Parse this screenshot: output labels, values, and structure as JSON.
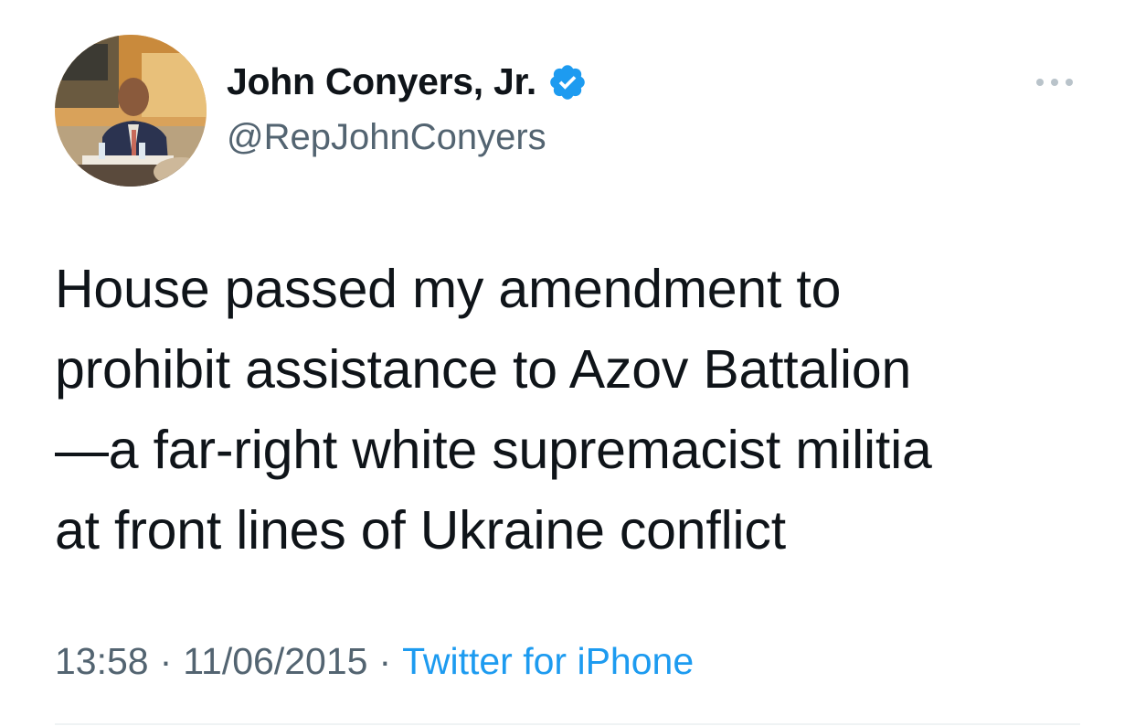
{
  "tweet": {
    "author": {
      "display_name": "John Conyers, Jr.",
      "handle": "@RepJohnConyers",
      "verified": true,
      "avatar_icon": "profile-photo"
    },
    "more_icon": "more-options-icon",
    "text": "House passed my amendment to\nprohibit assistance to Azov Battalion\n—a far-right white supremacist militia\nat front lines of Ukraine conflict",
    "meta": {
      "time": "13:58",
      "separator": "·",
      "date": "11/06/2015",
      "source": "Twitter for iPhone"
    }
  },
  "colors": {
    "text_primary": "#0f1419",
    "text_secondary": "#536471",
    "accent": "#1d9bf0",
    "divider": "#eff3f4"
  }
}
